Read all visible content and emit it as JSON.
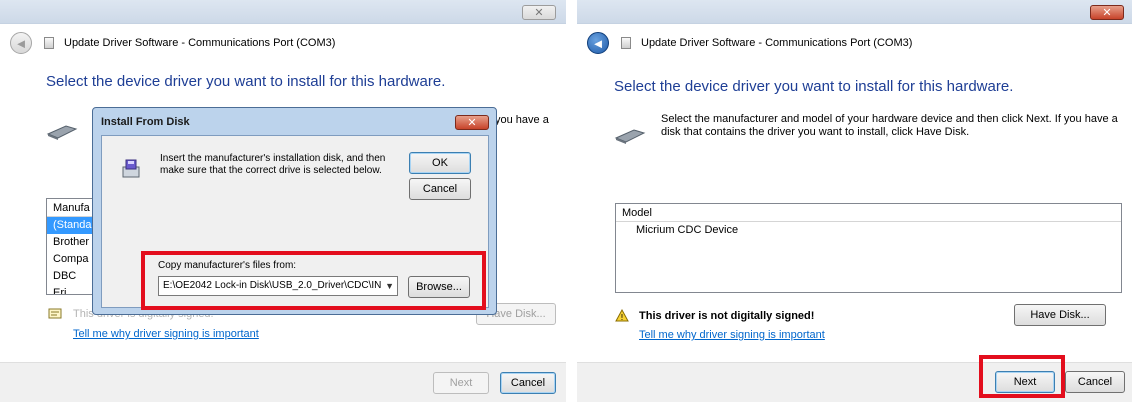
{
  "left_window": {
    "title": "Update Driver Software - Communications Port (COM3)",
    "back_glyph": "◄",
    "close_glyph": "✕",
    "heading": "Select the device driver you want to install for this hardware.",
    "instruction_partial": "you have a",
    "list_header": "Manufa",
    "manufacturers": [
      "(Standa",
      "Brother",
      "Compa",
      "DBC",
      "Eri"
    ],
    "signing_text": "This driver is digitally signed.",
    "have_disk_label": "Have Disk...",
    "signing_link": "Tell me why driver signing is important",
    "next_label": "Next",
    "cancel_label": "Cancel"
  },
  "install_dialog": {
    "title": "Install From Disk",
    "close_glyph": "✕",
    "message": "Insert the manufacturer's installation disk, and then make sure that the correct drive is selected below.",
    "ok_label": "OK",
    "cancel_label": "Cancel",
    "copy_label": "Copy manufacturer's files from:",
    "path_value": "E:\\OE2042 Lock-in Disk\\USB_2.0_Driver\\CDC\\IN",
    "dropdown_glyph": "▼",
    "browse_label": "Browse..."
  },
  "right_window": {
    "title": "Update Driver Software - Communications Port (COM3)",
    "back_glyph": "◄",
    "close_glyph": "✕",
    "heading": "Select the device driver you want to install for this hardware.",
    "instruction": "Select the manufacturer and model of your hardware device and then click Next. If you have a disk that contains the driver you want to install, click Have Disk.",
    "list_header": "Model",
    "models": [
      "Micrium CDC Device"
    ],
    "warning_glyph": "!",
    "warning_text": "This driver is not digitally signed!",
    "have_disk_label": "Have Disk...",
    "signing_link": "Tell me why driver signing is important",
    "next_label": "Next",
    "cancel_label": "Cancel"
  },
  "colors": {
    "heading_blue": "#1e3e95",
    "highlight_red": "#e30e1d",
    "selection_blue": "#3399ff",
    "link_blue": "#0066cc"
  }
}
